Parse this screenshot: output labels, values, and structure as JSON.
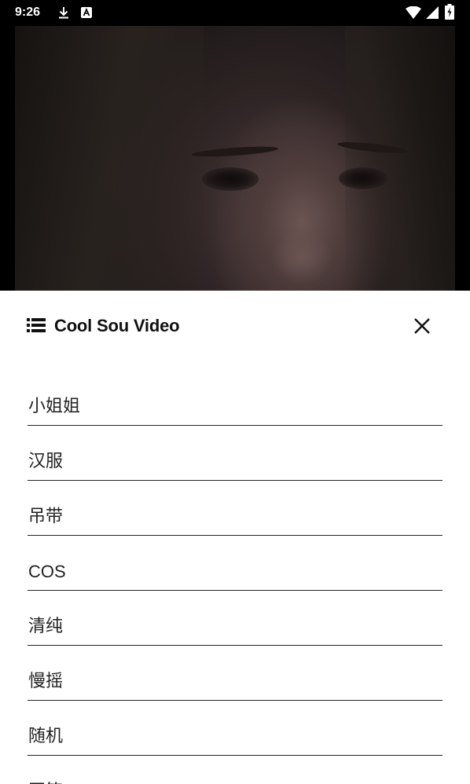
{
  "status_bar": {
    "time": "9:26",
    "icons": [
      "download-icon",
      "a-badge-icon",
      "wifi-icon",
      "signal-icon",
      "battery-charging-icon"
    ]
  },
  "video": {
    "description_icon": "video-frame"
  },
  "sheet": {
    "title": "Cool Sou Video",
    "title_icon": "list-icon",
    "close_icon": "close-icon",
    "items": [
      {
        "label": "小姐姐"
      },
      {
        "label": "汉服"
      },
      {
        "label": "吊带"
      },
      {
        "label": "COS"
      },
      {
        "label": "清纯"
      },
      {
        "label": "慢摇"
      },
      {
        "label": "随机"
      },
      {
        "label": "画笔"
      }
    ]
  },
  "colors": {
    "sheet_bg": "#ffffff",
    "text": "#222222",
    "divider": "#222222",
    "status_bg": "#000000"
  }
}
